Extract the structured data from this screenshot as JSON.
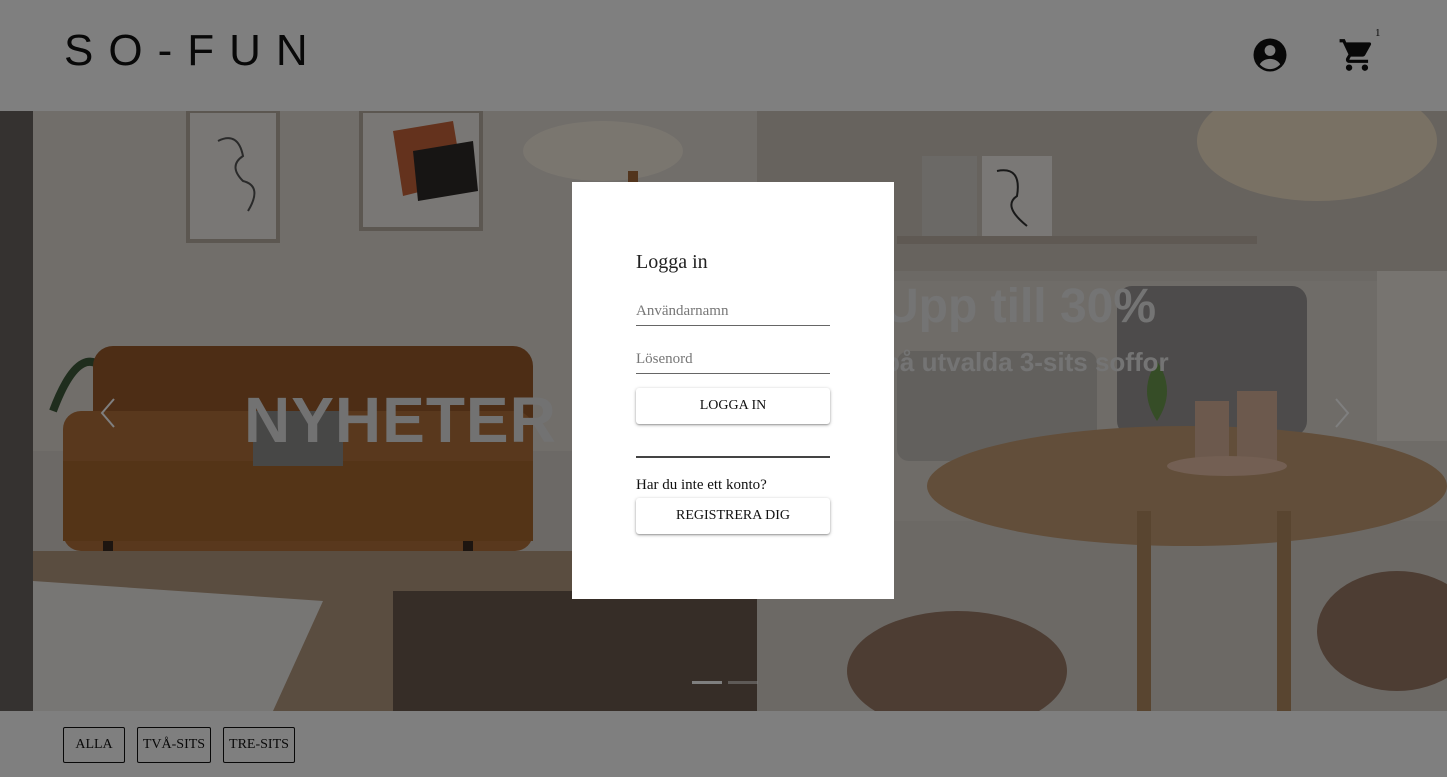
{
  "header": {
    "logo": "SO-FUN",
    "cart_count": "1"
  },
  "hero": {
    "slide_1_title": "NYHETER",
    "slide_2_title": "Upp till 30%",
    "slide_2_subtitle": "på utvalda 3-sits soffor",
    "indicators": 2,
    "active_indicator": 1
  },
  "filters": {
    "all": "ALLA",
    "two_seat": "TVÅ-SITS",
    "three_seat": "TRE-SITS"
  },
  "login_modal": {
    "title": "Logga in",
    "username_placeholder": "Användarnamn",
    "password_placeholder": "Lösenord",
    "login_button": "LOGGA IN",
    "no_account_text": "Har du inte ett konto?",
    "register_button": "REGISTRERA DIG"
  },
  "icons": {
    "account": "account-circle-icon",
    "cart": "shopping-cart-icon",
    "prev": "chevron-left-icon",
    "next": "chevron-right-icon"
  }
}
